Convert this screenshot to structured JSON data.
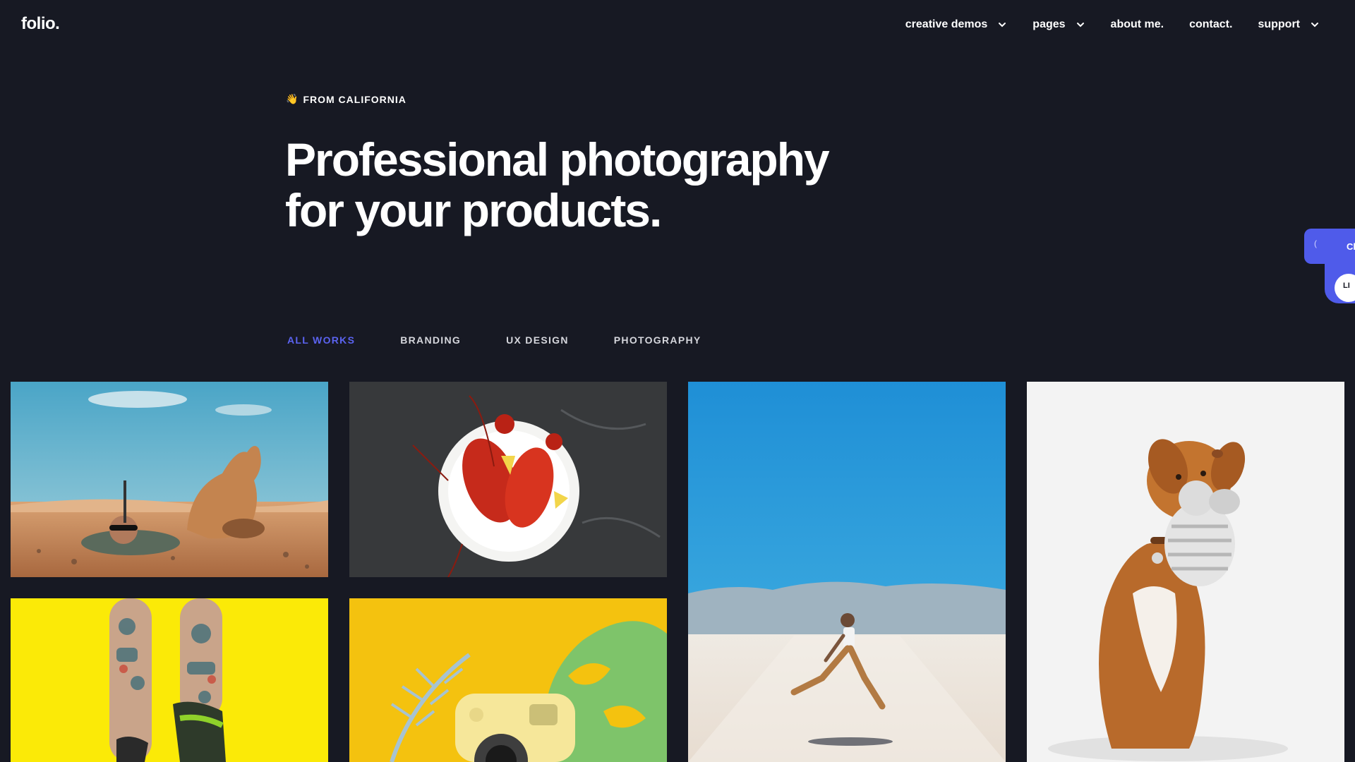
{
  "header": {
    "logo": "folio.",
    "nav": [
      {
        "label": "creative demos",
        "dropdown": true
      },
      {
        "label": "pages",
        "dropdown": true
      },
      {
        "label": "about me.",
        "dropdown": false
      },
      {
        "label": "contact.",
        "dropdown": false
      },
      {
        "label": "support",
        "dropdown": true
      }
    ]
  },
  "hero": {
    "eyebrow_icon": "👋",
    "eyebrow": "FROM CALIFORNIA",
    "headline_line1": "Professional photography",
    "headline_line2": "for your products."
  },
  "filters": {
    "items": [
      "ALL WORKS",
      "BRANDING",
      "UX DESIGN",
      "PHOTOGRAPHY"
    ],
    "active": "ALL WORKS"
  },
  "gallery": [
    {
      "name": "desert-camel-photo"
    },
    {
      "name": "lobster-plate-photo"
    },
    {
      "name": "salt-flat-runner-photo"
    },
    {
      "name": "dog-with-toy-photo"
    },
    {
      "name": "tattooed-legs-photo"
    },
    {
      "name": "instant-camera-photo"
    }
  ],
  "side_widget": {
    "label1": "Cl",
    "label2": "LI"
  },
  "colors": {
    "background": "#171923",
    "accent": "#5b63f0",
    "text": "#ffffff"
  }
}
